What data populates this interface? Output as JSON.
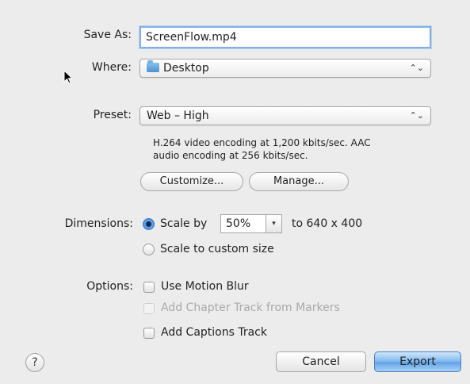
{
  "save_as": {
    "label": "Save As:",
    "value": "ScreenFlow.mp4"
  },
  "where": {
    "label": "Where:",
    "value": "Desktop",
    "icon": "folder-icon"
  },
  "preset": {
    "label": "Preset:",
    "value": "Web – High",
    "description_line1": "H.264 video encoding at 1,200 kbits/sec.  AAC",
    "description_line2": "audio encoding at 256 kbits/sec.",
    "customize_label": "Customize...",
    "manage_label": "Manage..."
  },
  "dimensions": {
    "label": "Dimensions:",
    "scale_by_label": "Scale by",
    "scale_value": "50%",
    "to_text": "to 640 x 400",
    "custom_label": "Scale to custom size",
    "selected": "scale_by"
  },
  "options": {
    "label": "Options:",
    "motion_blur": {
      "label": "Use Motion Blur",
      "checked": false,
      "enabled": true
    },
    "chapter_track": {
      "label": "Add Chapter Track from Markers",
      "checked": false,
      "enabled": false
    },
    "captions_track": {
      "label": "Add Captions Track",
      "checked": false,
      "enabled": true
    }
  },
  "footer": {
    "help_label": "?",
    "cancel_label": "Cancel",
    "export_label": "Export"
  },
  "popup_arrows": "⌃⌄",
  "combo_arrow": "▾",
  "colors": {
    "background": "#ececec",
    "focus_ring": "#84aee6",
    "default_button": "#5fa0e6"
  }
}
